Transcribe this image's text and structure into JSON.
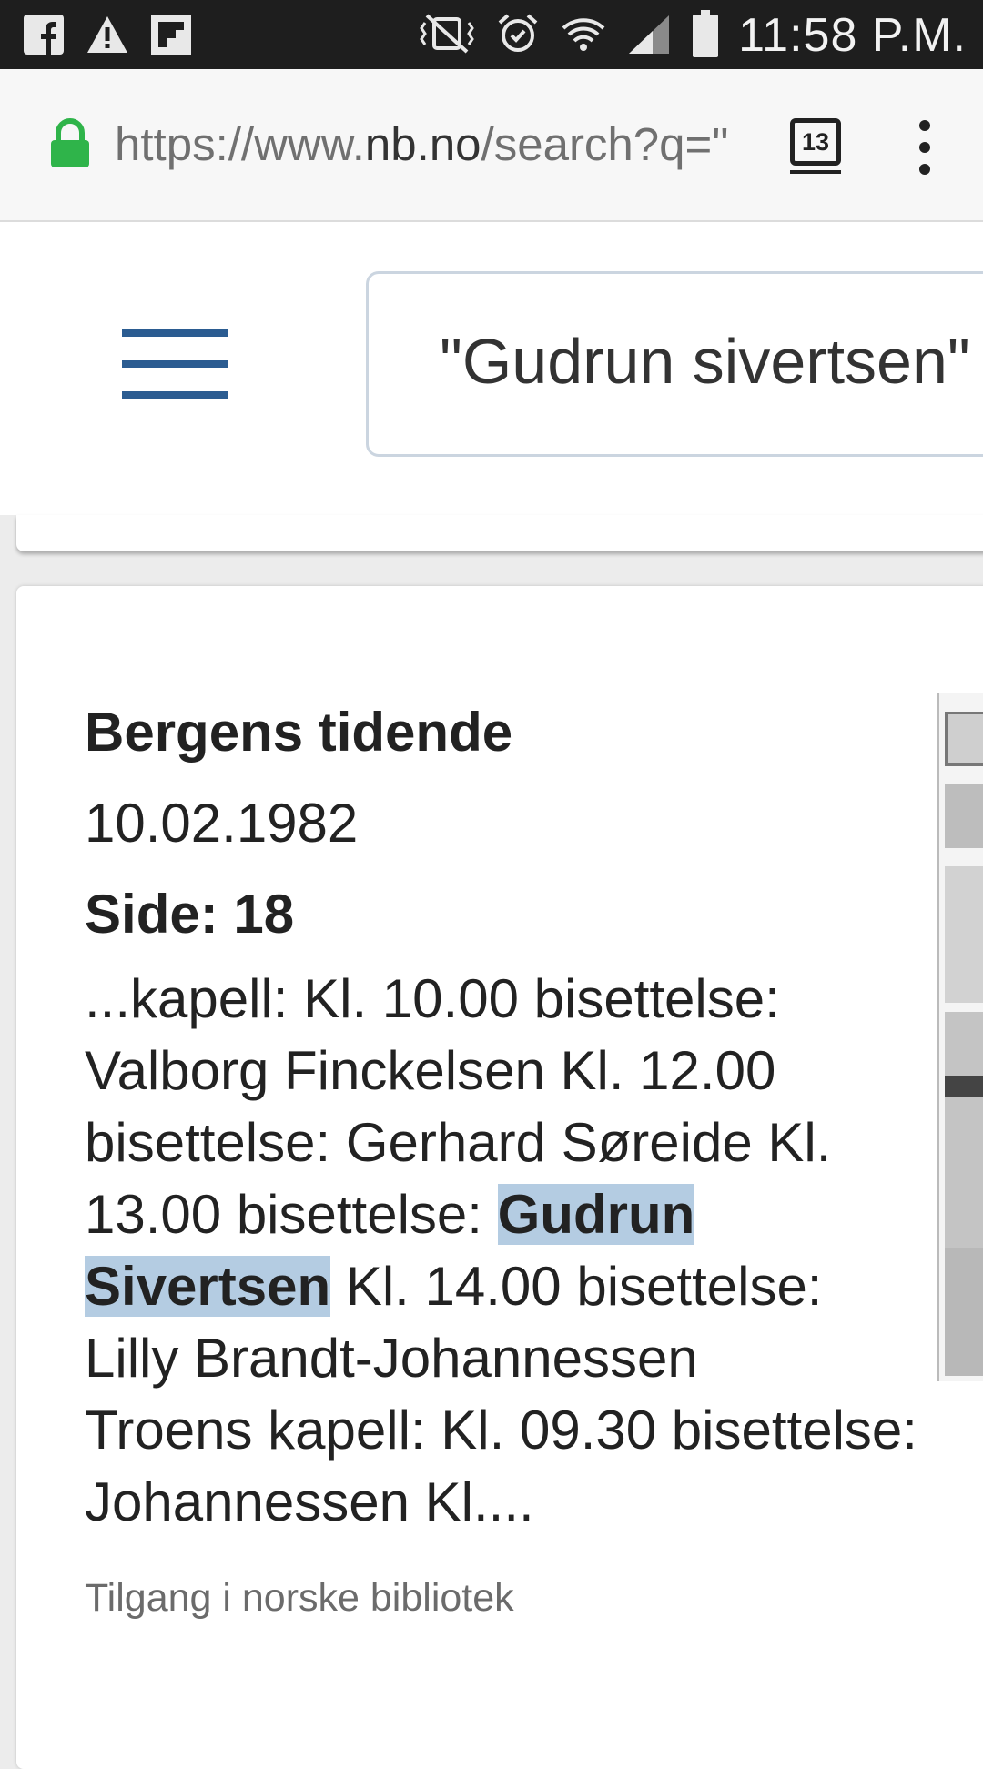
{
  "status_bar": {
    "time": "11:58 P.M.",
    "left_icons": [
      "facebook-icon",
      "warning-icon",
      "flipboard-icon"
    ],
    "right_icons": [
      "vibrate-icon",
      "alarm-icon",
      "wifi-icon",
      "signal-icon",
      "battery-icon"
    ]
  },
  "browser": {
    "url_scheme": "https://www.",
    "url_host": "nb.no",
    "url_path": "/search?q=\"",
    "tab_count": "13"
  },
  "search": {
    "query": "\"Gudrun sivertsen\""
  },
  "result": {
    "title": "Bergens tidende",
    "date": "10.02.1982",
    "page": "Side: 18",
    "snippet_lines": [
      "...kapell: Kl. 10.00 bisettelse:",
      "Valborg Finckelsen Kl. 12.00",
      "bisettelse: Gerhard Søreide Kl.",
      "13.00 bisettelse: ",
      "Gudrun",
      "Sivertsen",
      " Kl. 14.00 bisettelse:",
      "Lilly Brandt-Johannessen",
      "Troens kapell: Kl. 09.30 bisettelse:",
      "Johannessen Kl...."
    ],
    "access": "Tilgang i norske bibliotek"
  },
  "colors": {
    "status_bar": "#1e1e1e",
    "lock": "#2fb44a",
    "hamburger": "#2b5c91",
    "highlight": "#b4cce2"
  }
}
